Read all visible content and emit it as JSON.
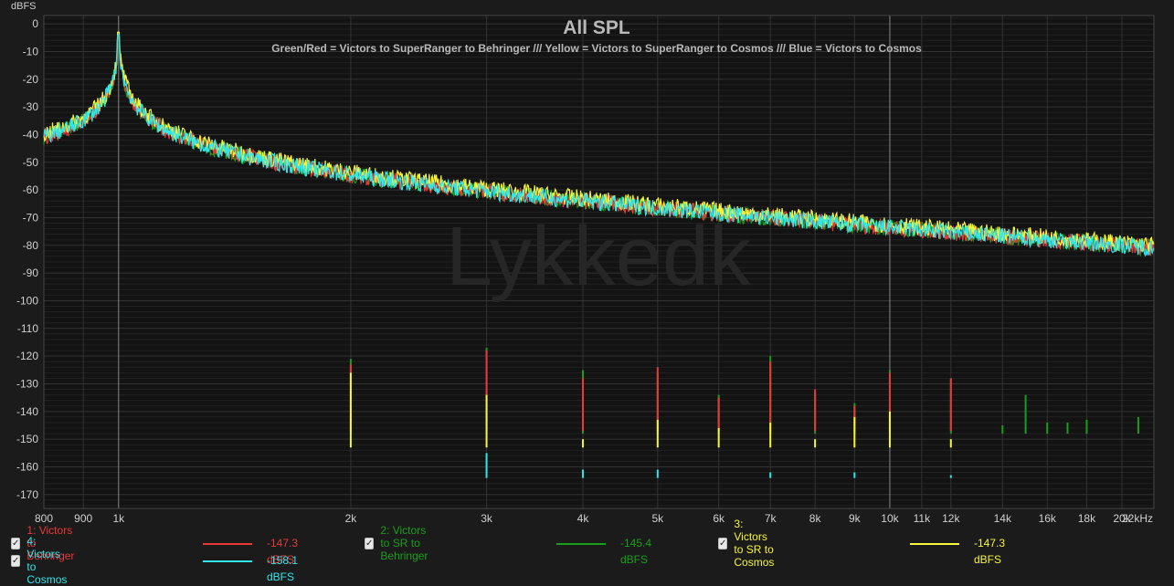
{
  "chart_data": {
    "type": "line",
    "title": "All SPL",
    "subtitle": "Green/Red = Victors to SuperRanger to Behringer /// Yellow = Victors to SuperRanger to Cosmos /// Blue = Victors to Cosmos",
    "watermark": "Lykkedk",
    "ylabel": "dBFS",
    "x_scale": "log",
    "xlim": [
      800,
      22000
    ],
    "ylim": [
      -175,
      3
    ],
    "y_ticks": [
      0,
      -10,
      -20,
      -30,
      -40,
      -50,
      -60,
      -70,
      -80,
      -90,
      -100,
      -110,
      -120,
      -130,
      -140,
      -150,
      -160,
      -170
    ],
    "y_tick_labels": [
      "0",
      "-10",
      "-20",
      "-30",
      "-40",
      "-50",
      "-60",
      "-70",
      "-80",
      "-90",
      "-100",
      "-110",
      "-120",
      "-130",
      "-140",
      "-150",
      "-160",
      "-170"
    ],
    "x_ticks": [
      800,
      900,
      1000,
      2000,
      3000,
      4000,
      5000,
      6000,
      7000,
      8000,
      9000,
      10000,
      11000,
      12000,
      14000,
      16000,
      18000,
      20000,
      22000
    ],
    "x_tick_labels": [
      "800",
      "900",
      "1k",
      "2k",
      "3k",
      "4k",
      "5k",
      "6k",
      "7k",
      "8k",
      "9k",
      "10k",
      "11k",
      "12k",
      "14k",
      "16k",
      "18k",
      "20k",
      "22kHz"
    ],
    "grid": true,
    "legend_position": "bottom",
    "fundamental_hz": 1000,
    "series": [
      {
        "name": "1: Victors to Behringer",
        "color": "#e8393a",
        "level_label": "-147.3 dBFS",
        "peak_db": -4,
        "floor_db": -150,
        "harmonics": [
          [
            2000,
            -123
          ],
          [
            3000,
            -118
          ],
          [
            4000,
            -128
          ],
          [
            5000,
            -124
          ],
          [
            6000,
            -135
          ],
          [
            7000,
            -122
          ],
          [
            8000,
            -132
          ],
          [
            9000,
            -138
          ],
          [
            10000,
            -126
          ],
          [
            12000,
            -128
          ]
        ]
      },
      {
        "name": "2: Victors to SR to Behringer",
        "color": "#1a9e1a",
        "level_label": "-145.4 dBFS",
        "peak_db": -4,
        "floor_db": -151,
        "harmonics": [
          [
            2000,
            -121
          ],
          [
            3000,
            -117
          ],
          [
            4000,
            -125
          ],
          [
            5000,
            -126
          ],
          [
            6000,
            -134
          ],
          [
            7000,
            -120
          ],
          [
            8000,
            -133
          ],
          [
            9000,
            -137
          ],
          [
            10000,
            -125
          ],
          [
            12000,
            -128
          ],
          [
            14000,
            -145
          ],
          [
            15000,
            -134
          ],
          [
            16000,
            -144
          ],
          [
            17000,
            -144
          ],
          [
            18000,
            -143
          ],
          [
            21000,
            -142
          ]
        ]
      },
      {
        "name": "3: Victors to SR to Cosmos",
        "color": "#f5f53a",
        "level_label": "-147.3 dBFS",
        "peak_db": -3,
        "floor_db": -156,
        "harmonics": [
          [
            2000,
            -126
          ],
          [
            3000,
            -134
          ],
          [
            4000,
            -150
          ],
          [
            5000,
            -143
          ],
          [
            6000,
            -146
          ],
          [
            7000,
            -144
          ],
          [
            8000,
            -150
          ],
          [
            9000,
            -142
          ],
          [
            10000,
            -140
          ],
          [
            12000,
            -150
          ]
        ]
      },
      {
        "name": "4: Victors to Cosmos",
        "color": "#2fe6ea",
        "level_label": "-158.1 dBFS",
        "peak_db": -4,
        "floor_db": -167,
        "harmonics": [
          [
            3000,
            -155
          ],
          [
            4000,
            -161
          ],
          [
            5000,
            -161
          ],
          [
            7000,
            -162
          ],
          [
            9000,
            -162
          ],
          [
            12000,
            -163
          ]
        ]
      }
    ]
  }
}
